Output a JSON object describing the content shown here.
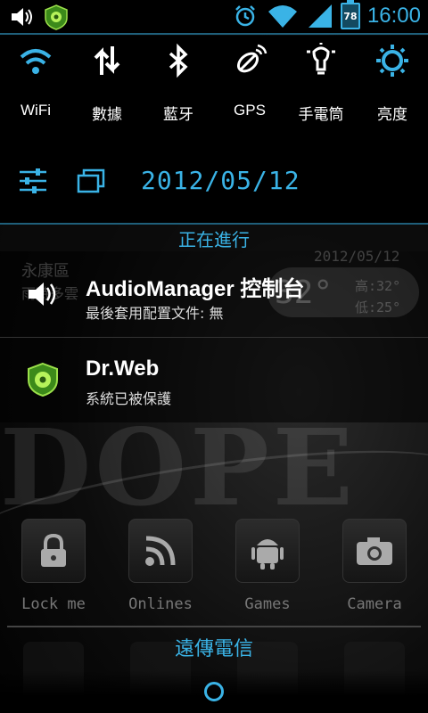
{
  "status_bar": {
    "time": "16:00",
    "battery_level": "78",
    "left_icons": [
      "volume-icon",
      "drweb-icon"
    ],
    "right_icons": [
      "alarm-icon",
      "wifi-icon",
      "signal-icon",
      "battery-icon"
    ]
  },
  "quick_toggles": [
    {
      "label": "WiFi",
      "icon": "wifi-icon"
    },
    {
      "label": "數據",
      "icon": "data-icon"
    },
    {
      "label": "藍牙",
      "icon": "bluetooth-icon"
    },
    {
      "label": "GPS",
      "icon": "gps-icon"
    },
    {
      "label": "手電筒",
      "icon": "flashlight-icon"
    },
    {
      "label": "亮度",
      "icon": "brightness-icon"
    }
  ],
  "settings_row": {
    "date": "2012/05/12",
    "icons": [
      "settings-sliders-icon",
      "recent-apps-icon"
    ]
  },
  "ongoing": {
    "header": "正在進行"
  },
  "notifications": [
    {
      "title": "AudioManager 控制台",
      "subtitle": "最後套用配置文件: 無",
      "icon": "volume-icon"
    },
    {
      "title": "Dr.Web",
      "subtitle": "系統已被保護",
      "icon": "drweb-icon"
    }
  ],
  "background_widget": {
    "location": "永康區",
    "condition": "雨時多雲",
    "date": "2012/05/12",
    "temp": "32°",
    "high": "高:32°",
    "low": "低:25°",
    "wallpaper_text": "DOPE"
  },
  "apps": [
    {
      "label": "Lock me",
      "icon": "lock-icon"
    },
    {
      "label": "Onlines",
      "icon": "rss-icon"
    },
    {
      "label": "Games",
      "icon": "android-icon"
    },
    {
      "label": "Camera",
      "icon": "camera-icon"
    }
  ],
  "carrier": "遠傳電信",
  "colors": {
    "accent": "#3ab3e6",
    "background": "#000000"
  }
}
